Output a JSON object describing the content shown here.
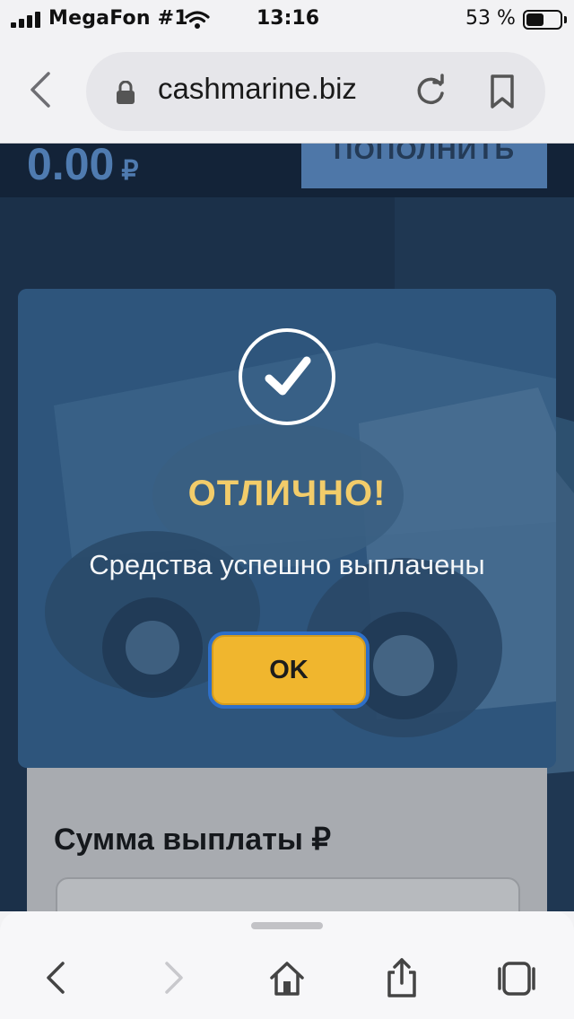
{
  "status_bar": {
    "carrier": "MegaFon #1",
    "time": "13:16",
    "battery_percent_text": "53 %",
    "battery_level": 0.53,
    "signal_bars": 4
  },
  "browser": {
    "url": "cashmarine.biz",
    "icons": [
      "back-icon",
      "lock-icon",
      "reload-icon",
      "bookmark-icon"
    ]
  },
  "page": {
    "balance_value": "0.00",
    "balance_currency": "₽",
    "topup_label": "ПОПОЛНИТЬ",
    "payout_label": "Сумма выплаты ₽"
  },
  "modal": {
    "icon": "checkmark-icon",
    "title": "ОТЛИЧНО!",
    "message": "Средства успешно выплачены",
    "ok_label": "OK"
  },
  "toolbar": {
    "icons": [
      "back-icon",
      "forward-icon",
      "home-icon",
      "share-icon",
      "tabs-icon"
    ]
  },
  "colors": {
    "page_bg": "#1a2f48",
    "modal_bg": "#2c527a",
    "title_accent": "#f2cc6a",
    "ok_button": "#f0b62e",
    "focus_ring": "#2e6fc8"
  }
}
